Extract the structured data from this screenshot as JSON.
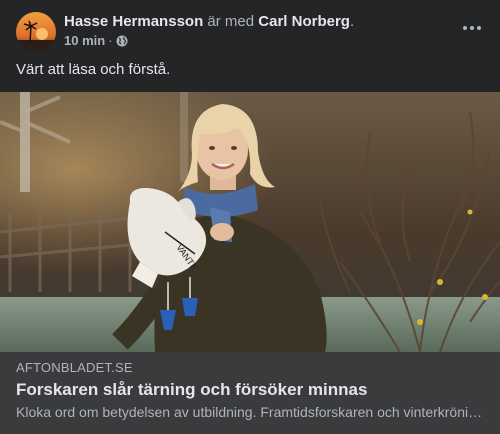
{
  "post": {
    "author": "Hasse Hermansson",
    "with_text": "är med",
    "tagged": "Carl Norberg",
    "period": ".",
    "time": "10 min",
    "separator": "·",
    "privacy_icon": "globe-icon",
    "text": "Värt att läsa och förstå."
  },
  "link": {
    "domain": "AFTONBLADET.SE",
    "headline": "Forskaren slår tärning och försöker minnas",
    "description": "Kloka ord om betydelsen av utbildning. Framtidsforskaren och vinterkrönikören Kjell A Nordström"
  },
  "colors": {
    "background": "#242526",
    "link_box": "#3a3b3c",
    "primary_text": "#e4e6eb",
    "secondary_text": "#b0b3b8"
  }
}
